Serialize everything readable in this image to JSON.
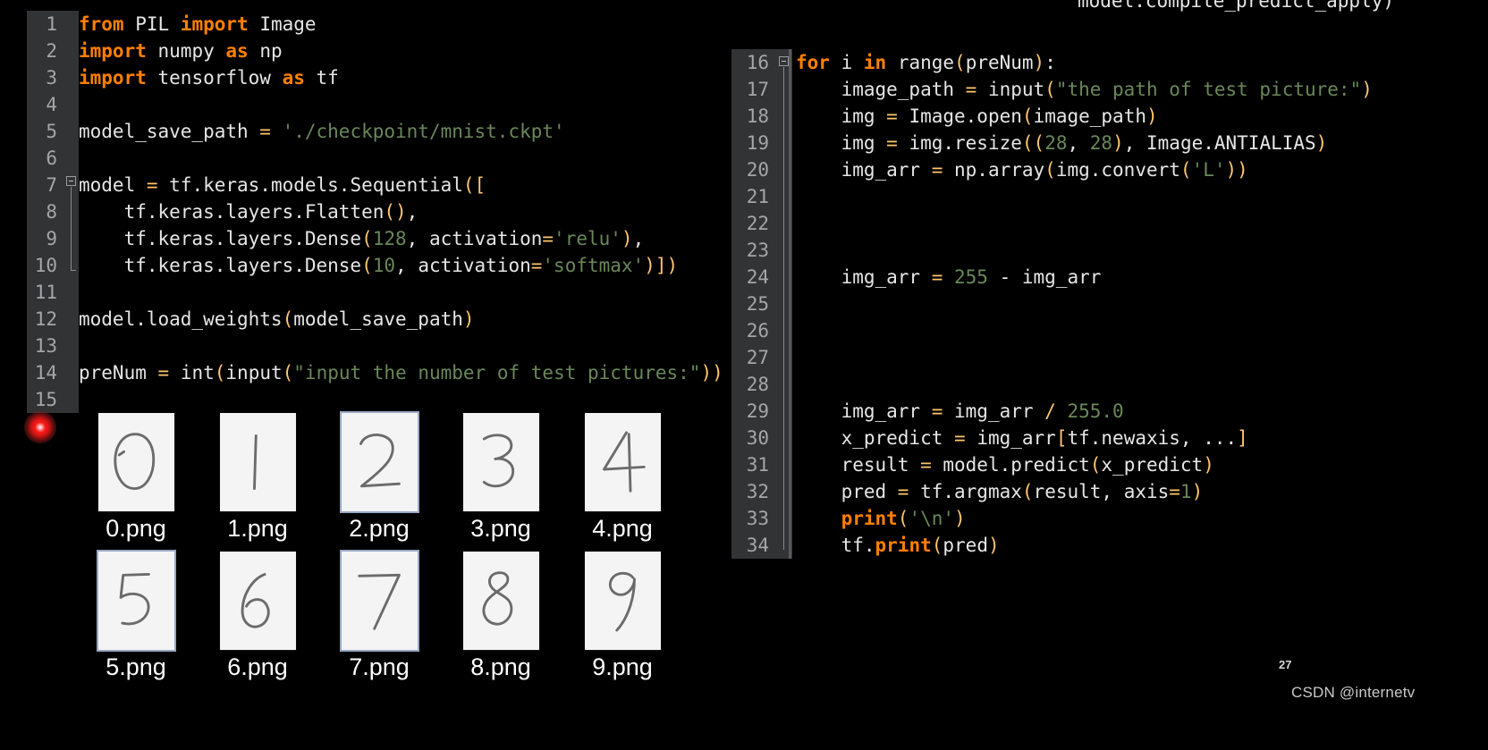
{
  "top_clipped_line": "model.compile_predict_apply)",
  "editor_left": {
    "first_line_number": 1,
    "lines": [
      {
        "n": "1",
        "tokens": [
          {
            "t": "from ",
            "c": "kw"
          },
          {
            "t": "PIL ",
            "c": "id"
          },
          {
            "t": "import ",
            "c": "kw"
          },
          {
            "t": "Image",
            "c": "id"
          }
        ]
      },
      {
        "n": "2",
        "tokens": [
          {
            "t": "import ",
            "c": "kw"
          },
          {
            "t": "numpy ",
            "c": "id"
          },
          {
            "t": "as ",
            "c": "kw"
          },
          {
            "t": "np",
            "c": "id"
          }
        ]
      },
      {
        "n": "3",
        "tokens": [
          {
            "t": "import ",
            "c": "kw"
          },
          {
            "t": "tensorflow ",
            "c": "id"
          },
          {
            "t": "as ",
            "c": "kw"
          },
          {
            "t": "tf",
            "c": "id"
          }
        ]
      },
      {
        "n": "4",
        "tokens": []
      },
      {
        "n": "5",
        "tokens": [
          {
            "t": "model_save_path ",
            "c": "id"
          },
          {
            "t": "= ",
            "c": "op"
          },
          {
            "t": "'./checkpoint/mnist.ckpt'",
            "c": "str"
          }
        ]
      },
      {
        "n": "6",
        "tokens": []
      },
      {
        "n": "7",
        "tokens": [
          {
            "t": "model ",
            "c": "id"
          },
          {
            "t": "= ",
            "c": "op"
          },
          {
            "t": "tf.keras.models.Sequential",
            "c": "id"
          },
          {
            "t": "([",
            "c": "punc"
          }
        ]
      },
      {
        "n": "8",
        "tokens": [
          {
            "t": "    tf.keras.layers.Flatten",
            "c": "id"
          },
          {
            "t": "()",
            "c": "punc"
          },
          {
            "t": ",",
            "c": "id"
          }
        ]
      },
      {
        "n": "9",
        "tokens": [
          {
            "t": "    tf.keras.layers.Dense",
            "c": "id"
          },
          {
            "t": "(",
            "c": "punc"
          },
          {
            "t": "128",
            "c": "numlit"
          },
          {
            "t": ", activation",
            "c": "id"
          },
          {
            "t": "=",
            "c": "op"
          },
          {
            "t": "'relu'",
            "c": "str"
          },
          {
            "t": ")",
            "c": "punc"
          },
          {
            "t": ",",
            "c": "id"
          }
        ]
      },
      {
        "n": "10",
        "tokens": [
          {
            "t": "    tf.keras.layers.Dense",
            "c": "id"
          },
          {
            "t": "(",
            "c": "punc"
          },
          {
            "t": "10",
            "c": "numlit"
          },
          {
            "t": ", activation",
            "c": "id"
          },
          {
            "t": "=",
            "c": "op"
          },
          {
            "t": "'softmax'",
            "c": "str"
          },
          {
            "t": ")])",
            "c": "punc"
          }
        ]
      },
      {
        "n": "11",
        "tokens": []
      },
      {
        "n": "12",
        "tokens": [
          {
            "t": "model.load_weights",
            "c": "id"
          },
          {
            "t": "(",
            "c": "punc"
          },
          {
            "t": "model_save_path",
            "c": "id"
          },
          {
            "t": ")",
            "c": "punc"
          }
        ]
      },
      {
        "n": "13",
        "tokens": []
      },
      {
        "n": "14",
        "tokens": [
          {
            "t": "preNum ",
            "c": "id"
          },
          {
            "t": "= ",
            "c": "op"
          },
          {
            "t": "int",
            "c": "id"
          },
          {
            "t": "(",
            "c": "punc"
          },
          {
            "t": "input",
            "c": "id"
          },
          {
            "t": "(",
            "c": "punc"
          },
          {
            "t": "\"input the number of test pictures:\"",
            "c": "str"
          },
          {
            "t": "))",
            "c": "punc"
          }
        ]
      },
      {
        "n": "15",
        "tokens": []
      }
    ]
  },
  "editor_right": {
    "first_line_number": 16,
    "lines": [
      {
        "n": "16",
        "tokens": [
          {
            "t": "for ",
            "c": "kw"
          },
          {
            "t": "i ",
            "c": "id"
          },
          {
            "t": "in ",
            "c": "kw"
          },
          {
            "t": "range",
            "c": "id"
          },
          {
            "t": "(",
            "c": "punc"
          },
          {
            "t": "preNum",
            "c": "id"
          },
          {
            "t": ")",
            "c": "punc"
          },
          {
            "t": ":",
            "c": "id"
          }
        ]
      },
      {
        "n": "17",
        "tokens": [
          {
            "t": "    image_path ",
            "c": "id"
          },
          {
            "t": "= ",
            "c": "op"
          },
          {
            "t": "input",
            "c": "id"
          },
          {
            "t": "(",
            "c": "punc"
          },
          {
            "t": "\"the path of test picture:\"",
            "c": "str"
          },
          {
            "t": ")",
            "c": "punc"
          }
        ]
      },
      {
        "n": "18",
        "tokens": [
          {
            "t": "    img ",
            "c": "id"
          },
          {
            "t": "= ",
            "c": "op"
          },
          {
            "t": "Image.open",
            "c": "id"
          },
          {
            "t": "(",
            "c": "punc"
          },
          {
            "t": "image_path",
            "c": "id"
          },
          {
            "t": ")",
            "c": "punc"
          }
        ]
      },
      {
        "n": "19",
        "tokens": [
          {
            "t": "    img ",
            "c": "id"
          },
          {
            "t": "= ",
            "c": "op"
          },
          {
            "t": "img.resize",
            "c": "id"
          },
          {
            "t": "((",
            "c": "punc"
          },
          {
            "t": "28",
            "c": "numlit"
          },
          {
            "t": ", ",
            "c": "id"
          },
          {
            "t": "28",
            "c": "numlit"
          },
          {
            "t": ")",
            "c": "punc"
          },
          {
            "t": ", Image.ANTIALIAS",
            "c": "id"
          },
          {
            "t": ")",
            "c": "punc"
          }
        ]
      },
      {
        "n": "20",
        "tokens": [
          {
            "t": "    img_arr ",
            "c": "id"
          },
          {
            "t": "= ",
            "c": "op"
          },
          {
            "t": "np.array",
            "c": "id"
          },
          {
            "t": "(",
            "c": "punc"
          },
          {
            "t": "img.convert",
            "c": "id"
          },
          {
            "t": "(",
            "c": "punc"
          },
          {
            "t": "'L'",
            "c": "str"
          },
          {
            "t": "))",
            "c": "punc"
          }
        ]
      },
      {
        "n": "21",
        "tokens": []
      },
      {
        "n": "22",
        "tokens": []
      },
      {
        "n": "23",
        "tokens": []
      },
      {
        "n": "24",
        "tokens": [
          {
            "t": "    img_arr ",
            "c": "id"
          },
          {
            "t": "= ",
            "c": "op"
          },
          {
            "t": "255",
            "c": "numlit"
          },
          {
            "t": " - ",
            "c": "id"
          },
          {
            "t": "img_arr",
            "c": "id"
          }
        ]
      },
      {
        "n": "25",
        "tokens": []
      },
      {
        "n": "26",
        "tokens": []
      },
      {
        "n": "27",
        "tokens": []
      },
      {
        "n": "28",
        "tokens": []
      },
      {
        "n": "29",
        "tokens": [
          {
            "t": "    img_arr ",
            "c": "id"
          },
          {
            "t": "= ",
            "c": "op"
          },
          {
            "t": "img_arr ",
            "c": "id"
          },
          {
            "t": "/ ",
            "c": "op"
          },
          {
            "t": "255.0",
            "c": "numlit"
          }
        ]
      },
      {
        "n": "30",
        "tokens": [
          {
            "t": "    x_predict ",
            "c": "id"
          },
          {
            "t": "= ",
            "c": "op"
          },
          {
            "t": "img_arr",
            "c": "id"
          },
          {
            "t": "[",
            "c": "punc"
          },
          {
            "t": "tf.newaxis, ...",
            "c": "id"
          },
          {
            "t": "]",
            "c": "punc"
          }
        ]
      },
      {
        "n": "31",
        "tokens": [
          {
            "t": "    result ",
            "c": "id"
          },
          {
            "t": "= ",
            "c": "op"
          },
          {
            "t": "model.predict",
            "c": "id"
          },
          {
            "t": "(",
            "c": "punc"
          },
          {
            "t": "x_predict",
            "c": "id"
          },
          {
            "t": ")",
            "c": "punc"
          }
        ]
      },
      {
        "n": "32",
        "tokens": [
          {
            "t": "    pred ",
            "c": "id"
          },
          {
            "t": "= ",
            "c": "op"
          },
          {
            "t": "tf.argmax",
            "c": "id"
          },
          {
            "t": "(",
            "c": "punc"
          },
          {
            "t": "result, axis",
            "c": "id"
          },
          {
            "t": "=",
            "c": "op"
          },
          {
            "t": "1",
            "c": "numlit"
          },
          {
            "t": ")",
            "c": "punc"
          }
        ]
      },
      {
        "n": "33",
        "tokens": [
          {
            "t": "    ",
            "c": "id"
          },
          {
            "t": "print",
            "c": "builtin"
          },
          {
            "t": "(",
            "c": "punc"
          },
          {
            "t": "'\\n'",
            "c": "str"
          },
          {
            "t": ")",
            "c": "punc"
          }
        ]
      },
      {
        "n": "34",
        "tokens": [
          {
            "t": "    tf.",
            "c": "id"
          },
          {
            "t": "print",
            "c": "builtin"
          },
          {
            "t": "(",
            "c": "punc"
          },
          {
            "t": "pred",
            "c": "id"
          },
          {
            "t": ")",
            "c": "punc"
          }
        ]
      }
    ]
  },
  "thumbnails": {
    "rows": [
      [
        {
          "label": "0.png",
          "digit": "0",
          "selected": false
        },
        {
          "label": "1.png",
          "digit": "1",
          "selected": false
        },
        {
          "label": "2.png",
          "digit": "2",
          "selected": true
        },
        {
          "label": "3.png",
          "digit": "3",
          "selected": false
        },
        {
          "label": "4.png",
          "digit": "4",
          "selected": false
        }
      ],
      [
        {
          "label": "5.png",
          "digit": "5",
          "selected": true
        },
        {
          "label": "6.png",
          "digit": "6",
          "selected": false
        },
        {
          "label": "7.png",
          "digit": "7",
          "selected": true
        },
        {
          "label": "8.png",
          "digit": "8",
          "selected": false
        },
        {
          "label": "9.png",
          "digit": "9",
          "selected": false
        }
      ]
    ]
  },
  "overlay": {
    "cursor_indicator": "red-recording-dot",
    "page_number": "27",
    "watermark": "CSDN @internetv"
  },
  "colors": {
    "background": "#000000",
    "gutter": "#313335",
    "line_number": "#a6a6a6",
    "keyword": "#ff8000",
    "string": "#6a8759",
    "number": "#6a8759",
    "operator": "#ffc66d",
    "identifier": "#e6e6e6",
    "accent_red": "#ff1a1a"
  }
}
